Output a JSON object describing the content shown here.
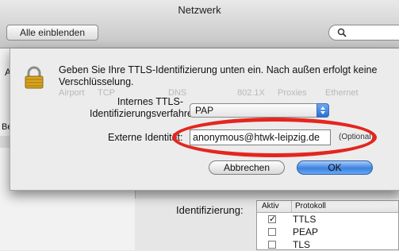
{
  "window": {
    "title": "Netzwerk"
  },
  "toolbar": {
    "show_all_label": "Alle einblenden",
    "search_placeholder": ""
  },
  "background": {
    "left_letter": "A",
    "left_label": "Be",
    "ghost_tabs": [
      "Airport",
      "TCP",
      "DNS",
      "802.1X",
      "Proxies",
      "Ethernet"
    ],
    "identification_label": "Identifizierung:",
    "protocol_table": {
      "headers": [
        "Aktiv",
        "Protokoll"
      ],
      "rows": [
        {
          "active": true,
          "protocol": "TTLS"
        },
        {
          "active": false,
          "protocol": "PEAP"
        },
        {
          "active": false,
          "protocol": "TLS"
        }
      ]
    }
  },
  "sheet": {
    "message": "Geben Sie Ihre TTLS-Identifizierung unten ein. Nach außen erfolgt keine Verschlüsselung.",
    "method_label": "Internes TTLS-Identifizierungsverfahren:",
    "method_value": "PAP",
    "external_label": "Externe Identität:",
    "external_value": "anonymous@htwk-leipzig.de",
    "optional_label": "(Optional)",
    "cancel_label": "Abbrechen",
    "ok_label": "OK"
  },
  "colors": {
    "highlight_oval": "#e3261f",
    "default_button": "#3b82e0"
  }
}
